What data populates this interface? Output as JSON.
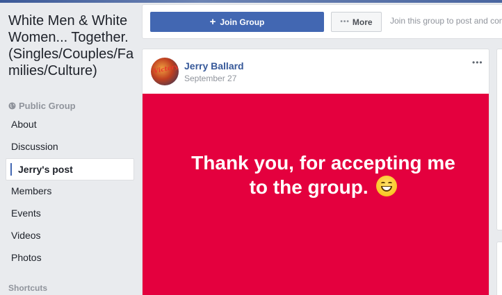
{
  "group": {
    "title": "White Men & White Women... Together. (Singles/Couples/Families/Culture)",
    "privacy_label": "Public Group",
    "privacy_icon": "globe-icon"
  },
  "sidebar": {
    "items": [
      {
        "label": "About"
      },
      {
        "label": "Discussion"
      },
      {
        "label": "Jerry's post",
        "active": true
      },
      {
        "label": "Members"
      },
      {
        "label": "Events"
      },
      {
        "label": "Videos"
      },
      {
        "label": "Photos"
      }
    ],
    "shortcuts_label": "Shortcuts"
  },
  "action_bar": {
    "join_label": "Join Group",
    "join_icon": "plus-icon",
    "more_label": "More",
    "more_icon": "dots-icon",
    "hint": "Join this group to post and comment."
  },
  "post": {
    "author": "Jerry Ballard",
    "date": "September 27",
    "avatar_text": "Victory",
    "text_line1": "Thank you, for accepting me",
    "text_line2": "to the group.",
    "emoji": "grinning-face-icon",
    "background_color": "#e4003e",
    "menu_icon": "ellipsis-icon"
  },
  "colors": {
    "brand": "#4267b2",
    "link": "#365899",
    "page_bg": "#e9ebee"
  }
}
